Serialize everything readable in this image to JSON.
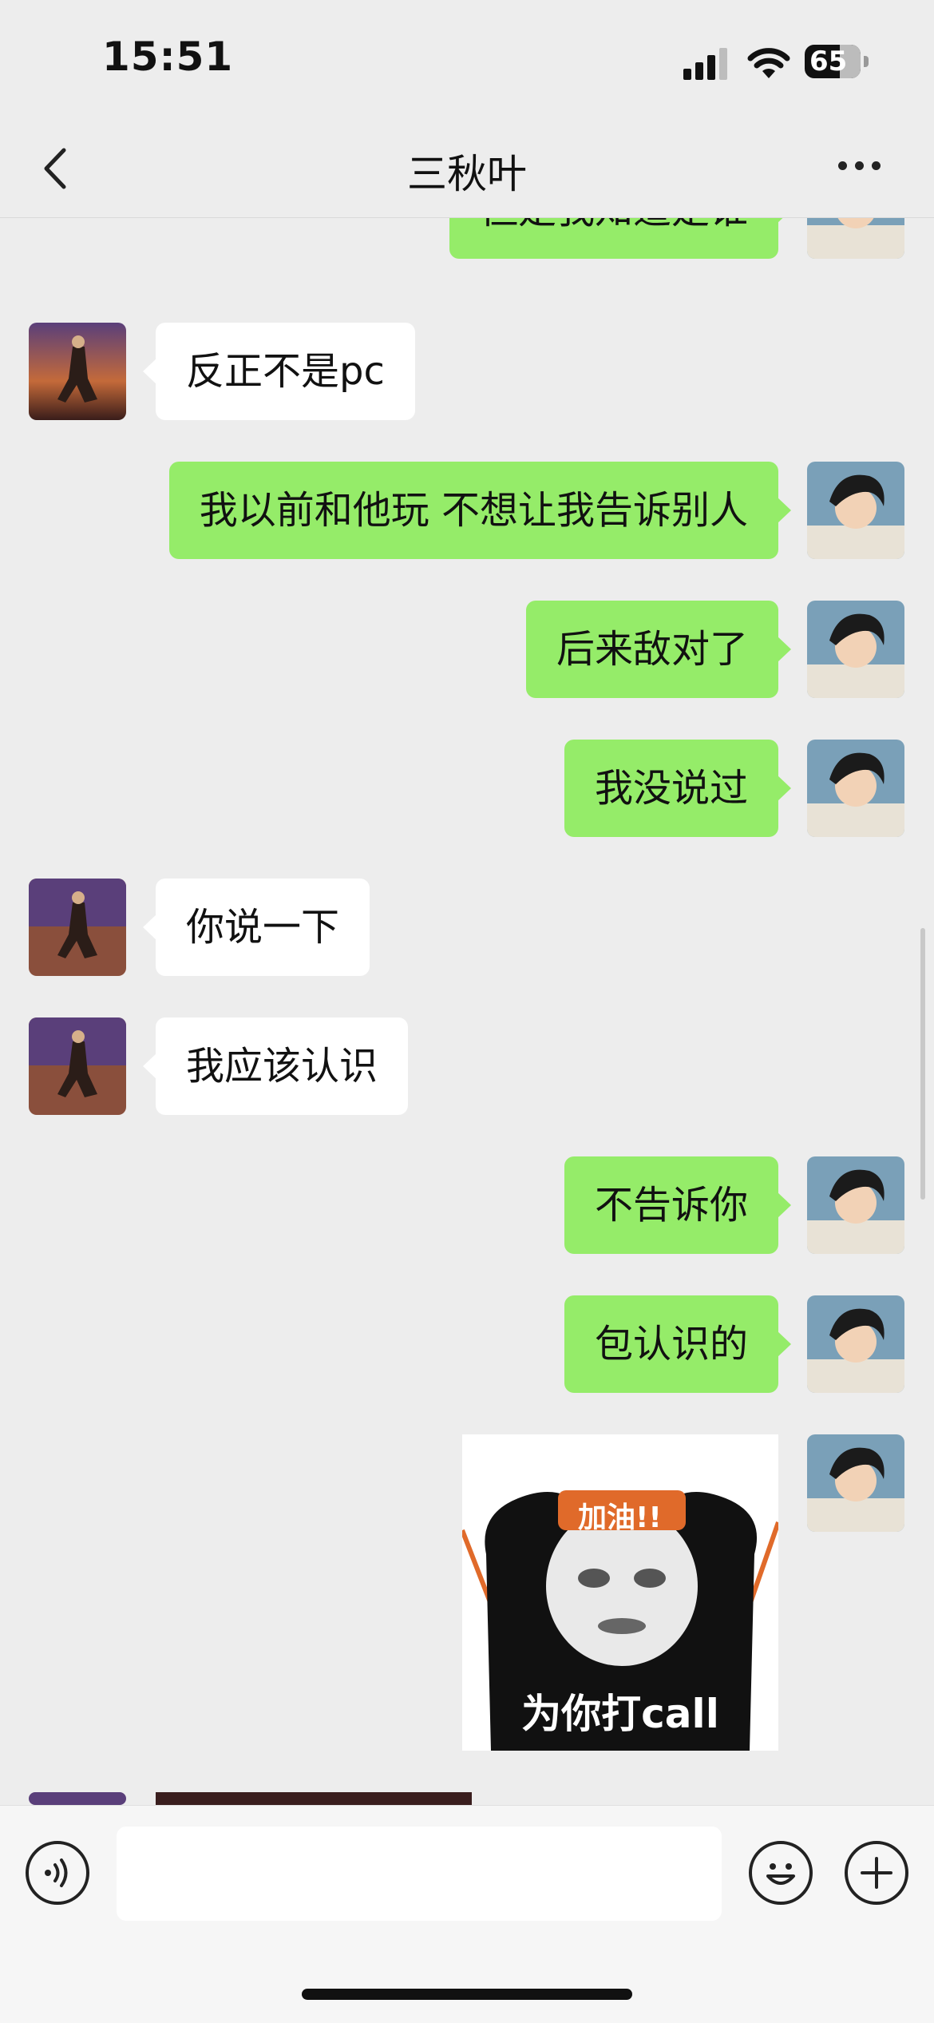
{
  "status_bar": {
    "time": "15:51",
    "battery": "65"
  },
  "header": {
    "title": "三秋叶"
  },
  "messages": [
    {
      "sender": "me",
      "text": "但是我知道是谁"
    },
    {
      "sender": "other",
      "text": "反正不是pc"
    },
    {
      "sender": "me",
      "text": "我以前和他玩 不想让我告诉别人"
    },
    {
      "sender": "me",
      "text": "后来敌对了"
    },
    {
      "sender": "me",
      "text": "我没说过"
    },
    {
      "sender": "other",
      "text": "你说一下"
    },
    {
      "sender": "other",
      "text": "我应该认识"
    },
    {
      "sender": "me",
      "text": "不告诉你"
    },
    {
      "sender": "me",
      "text": "包认识的"
    },
    {
      "sender": "me",
      "type": "sticker",
      "top_text": "加油!!",
      "bottom_text": "为你打call"
    },
    {
      "sender": "other",
      "type": "image"
    }
  ],
  "input_bar": {
    "icons": [
      "voice-icon",
      "emoji-icon",
      "plus-icon"
    ],
    "placeholder": ""
  },
  "colors": {
    "background": "#ededed",
    "my_bubble": "#95ec69",
    "their_bubble": "#ffffff"
  }
}
